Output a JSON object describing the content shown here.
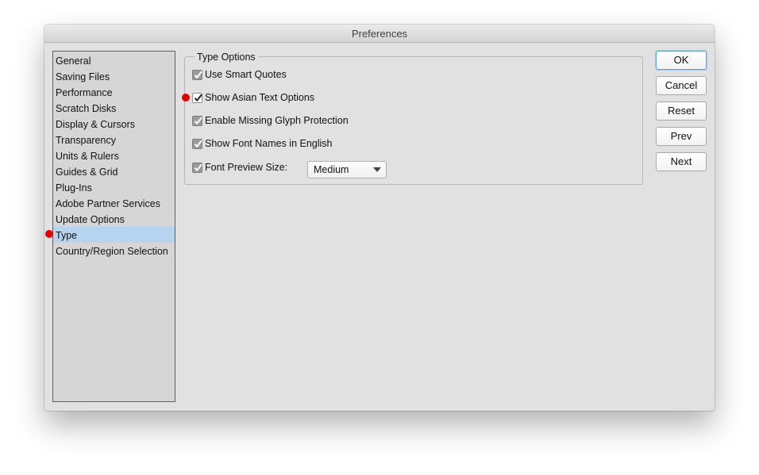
{
  "window": {
    "title": "Preferences"
  },
  "sidebar": {
    "items": [
      {
        "label": "General"
      },
      {
        "label": "Saving Files"
      },
      {
        "label": "Performance"
      },
      {
        "label": "Scratch Disks"
      },
      {
        "label": "Display & Cursors"
      },
      {
        "label": "Transparency"
      },
      {
        "label": "Units & Rulers"
      },
      {
        "label": "Guides & Grid"
      },
      {
        "label": "Plug-Ins"
      },
      {
        "label": "Adobe Partner Services"
      },
      {
        "label": "Update Options"
      },
      {
        "label": "Type",
        "selected": true
      },
      {
        "label": "Country/Region Selection"
      }
    ]
  },
  "type_options": {
    "legend": "Type Options",
    "options": [
      {
        "label": "Use Smart Quotes",
        "checked": true
      },
      {
        "label": "Show Asian Text Options",
        "checked": true
      },
      {
        "label": "Enable Missing Glyph Protection",
        "checked": true
      },
      {
        "label": "Show Font Names in English",
        "checked": true
      },
      {
        "label": "Font Preview Size:",
        "checked": true
      }
    ],
    "font_preview_size": {
      "selected": "Medium"
    }
  },
  "buttons": {
    "ok": "OK",
    "cancel": "Cancel",
    "reset": "Reset",
    "prev": "Prev",
    "next": "Next"
  },
  "colors": {
    "selection": "#b6d3f1",
    "annotation_dot": "#e20000",
    "default_button_border": "#5d9ee6"
  }
}
